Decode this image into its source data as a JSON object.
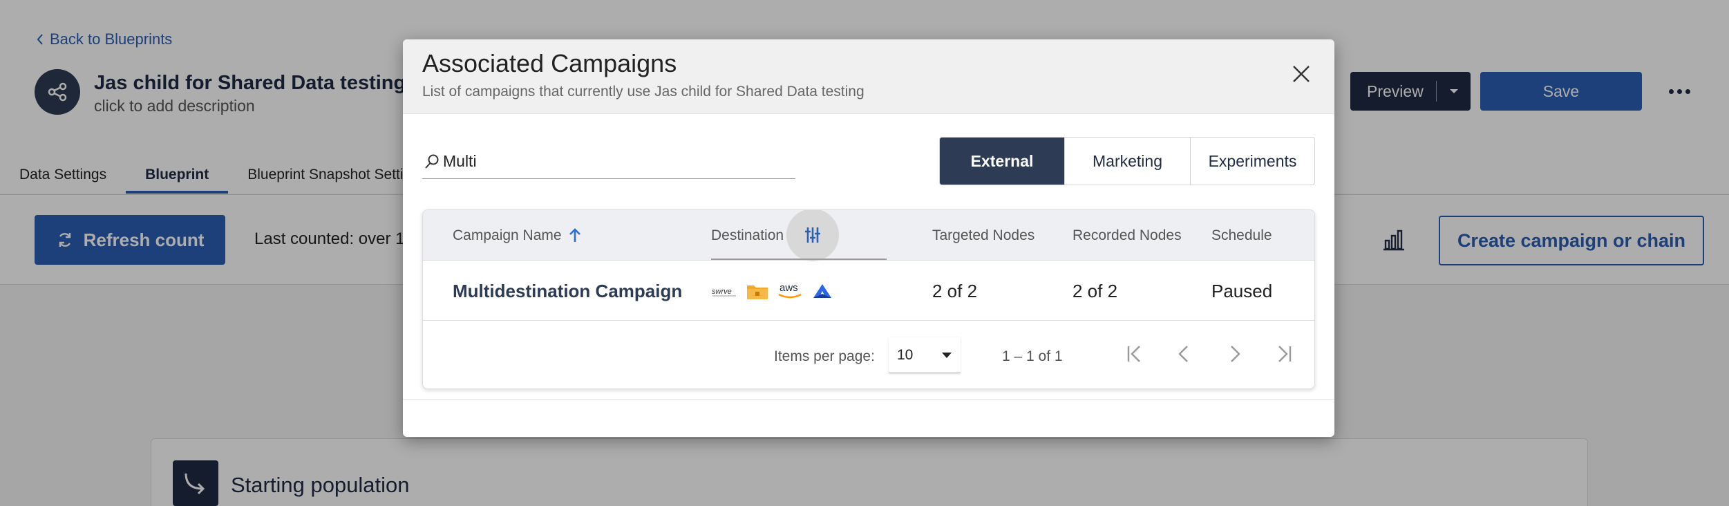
{
  "background": {
    "back_link": "Back to Blueprints",
    "blueprint_title": "Jas child for Shared Data testing",
    "blueprint_description": "click to add description",
    "tabs": [
      {
        "label": "Data Settings"
      },
      {
        "label": "Blueprint"
      },
      {
        "label": "Blueprint Snapshot Setting"
      }
    ],
    "preview_label": "Preview",
    "save_label": "Save",
    "refresh_label": "Refresh count",
    "last_counted": "Last counted: over 1",
    "create_label": "Create campaign or chain",
    "starting_population": "Starting population"
  },
  "modal": {
    "title": "Associated Campaigns",
    "subtitle": "List of campaigns that currently use Jas child for Shared Data testing",
    "search_value": "Multi",
    "segments": [
      "External",
      "Marketing",
      "Experiments"
    ],
    "active_segment": "External",
    "columns": {
      "name": "Campaign Name",
      "destination": "Destination",
      "targeted": "Targeted Nodes",
      "recorded": "Recorded Nodes",
      "schedule": "Schedule"
    },
    "sort": {
      "column": "Campaign Name",
      "direction": "ascending"
    },
    "rows": [
      {
        "name": "Multidestination Campaign",
        "destinations": [
          "swrve-icon",
          "folder-icon",
          "aws-icon",
          "atlassian-icon"
        ],
        "targeted": "2 of 2",
        "recorded": "2 of 2",
        "schedule": "Paused"
      }
    ],
    "pagination": {
      "items_per_page_label": "Items per page:",
      "items_per_page": "10",
      "range": "1 – 1 of 1"
    }
  },
  "logo_text": {
    "swrve": "swrve",
    "aws": "aws"
  },
  "colors": {
    "primary": "#2b5fb4",
    "navy": "#1f2a44",
    "active_segment": "#2e3b55"
  }
}
